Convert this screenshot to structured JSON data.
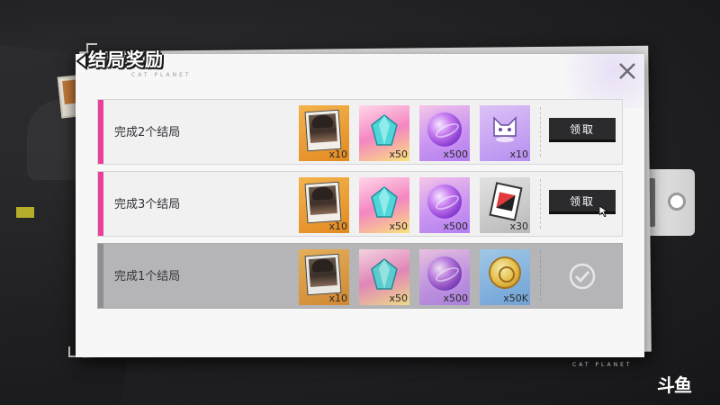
{
  "dialog": {
    "title": "结局奖励",
    "subtitle": "CAT PLANET",
    "footer": "CAT PLANET"
  },
  "rows": [
    {
      "label": "完成2个结局",
      "state": "claimable",
      "button_label": "领取",
      "rewards": [
        {
          "icon": "character-card-icon",
          "count": "x10"
        },
        {
          "icon": "blue-crystal-icon",
          "count": "x50"
        },
        {
          "icon": "purple-orb-icon",
          "count": "x500"
        },
        {
          "icon": "cat-avatar-icon",
          "count": "x10"
        }
      ]
    },
    {
      "label": "完成3个结局",
      "state": "claimable",
      "button_label": "领取",
      "rewards": [
        {
          "icon": "character-card-icon",
          "count": "x10"
        },
        {
          "icon": "blue-crystal-icon",
          "count": "x50"
        },
        {
          "icon": "purple-orb-icon",
          "count": "x500"
        },
        {
          "icon": "red-card-icon",
          "count": "x30"
        }
      ]
    },
    {
      "label": "完成1个结局",
      "state": "claimed",
      "rewards": [
        {
          "icon": "character-card-icon",
          "count": "x10"
        },
        {
          "icon": "blue-crystal-icon",
          "count": "x50"
        },
        {
          "icon": "purple-orb-icon",
          "count": "x500"
        },
        {
          "icon": "gold-coin-icon",
          "count": "x50K"
        }
      ]
    }
  ],
  "watermark": "斗鱼",
  "colors": {
    "accent_pink": "#e8409a",
    "claimed_gray": "#b5b5b7",
    "button_dark": "#2b2b2e"
  }
}
